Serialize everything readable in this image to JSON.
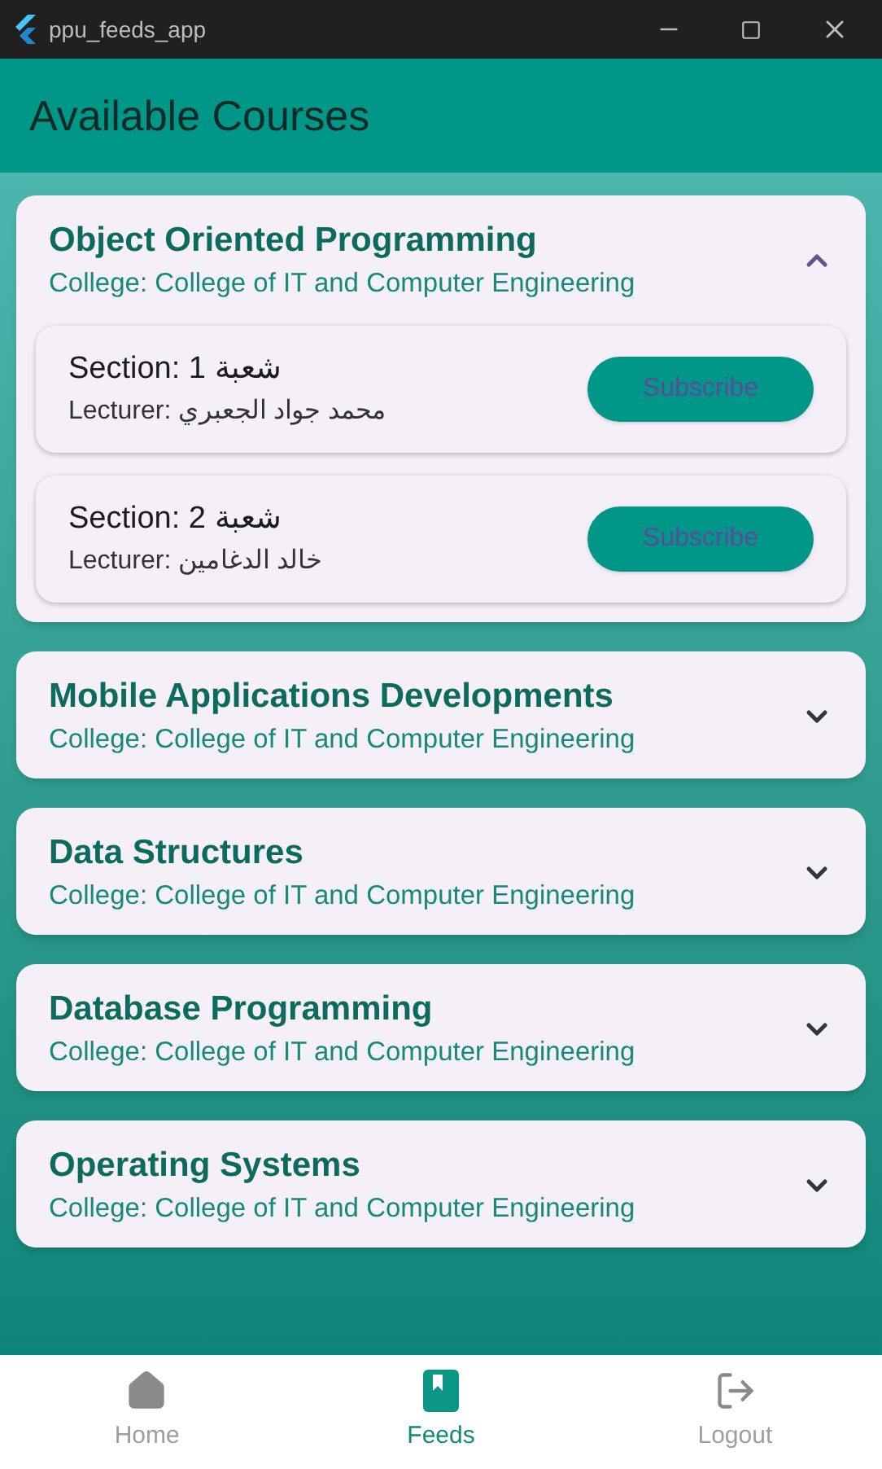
{
  "window": {
    "title": "ppu_feeds_app"
  },
  "app_bar": {
    "title": "Available Courses"
  },
  "courses": [
    {
      "name": "Object Oriented Programming",
      "college": "College: College of IT and Computer Engineering",
      "expanded": true,
      "sections": [
        {
          "section": "Section: 1 شعبة",
          "lecturer": "Lecturer: محمد جواد الجعبري",
          "button": "Subscribe"
        },
        {
          "section": "Section: 2 شعبة",
          "lecturer": "Lecturer: خالد الدغامين",
          "button": "Subscribe"
        }
      ]
    },
    {
      "name": "Mobile Applications Developments",
      "college": "College: College of IT and Computer Engineering",
      "expanded": false
    },
    {
      "name": "Data Structures",
      "college": "College: College of IT and Computer Engineering",
      "expanded": false
    },
    {
      "name": "Database Programming",
      "college": "College: College of IT and Computer Engineering",
      "expanded": false
    },
    {
      "name": "Operating Systems",
      "college": "College: College of IT and Computer Engineering",
      "expanded": false
    }
  ],
  "nav": [
    {
      "label": "Home",
      "kind": "home",
      "selected": false
    },
    {
      "label": "Feeds",
      "kind": "feeds",
      "selected": true
    },
    {
      "label": "Logout",
      "kind": "logout",
      "selected": false
    }
  ]
}
